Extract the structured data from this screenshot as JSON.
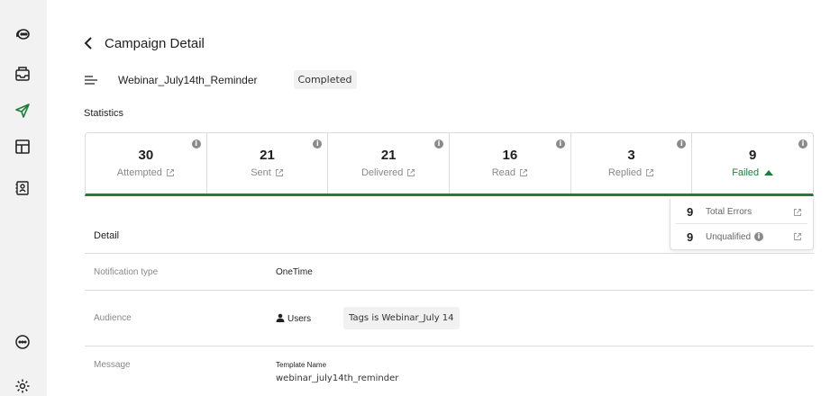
{
  "sidebar": {
    "top_icons": [
      "chat-bubble-icon",
      "inbox-icon",
      "send-icon",
      "layout-icon",
      "contact-card-icon"
    ],
    "bottom_icons": [
      "message-icon",
      "gear-icon"
    ],
    "active_color": "#1e7d3a"
  },
  "header": {
    "title": "Campaign Detail"
  },
  "campaign": {
    "name": "Webinar_July14th_Reminder",
    "status": "Completed"
  },
  "statistics": {
    "label": "Statistics",
    "items": [
      {
        "value": "30",
        "label": "Attempted"
      },
      {
        "value": "21",
        "label": "Sent"
      },
      {
        "value": "21",
        "label": "Delivered"
      },
      {
        "value": "16",
        "label": "Read"
      },
      {
        "value": "3",
        "label": "Replied"
      },
      {
        "value": "9",
        "label": "Failed"
      }
    ],
    "accent_color": "#1e7d3a"
  },
  "failed_breakdown": [
    {
      "count": "9",
      "label": "Total Errors"
    },
    {
      "count": "9",
      "label": "Unqualified"
    }
  ],
  "detail": {
    "title": "Detail",
    "notification_type_label": "Notification type",
    "notification_type_value": "OneTime",
    "audience_label": "Audience",
    "audience_value": "Users",
    "audience_tag": "Tags is Webinar_July 14",
    "message_label": "Message",
    "template_name_label": "Template Name",
    "template_name_value": "webinar_july14th_reminder"
  }
}
